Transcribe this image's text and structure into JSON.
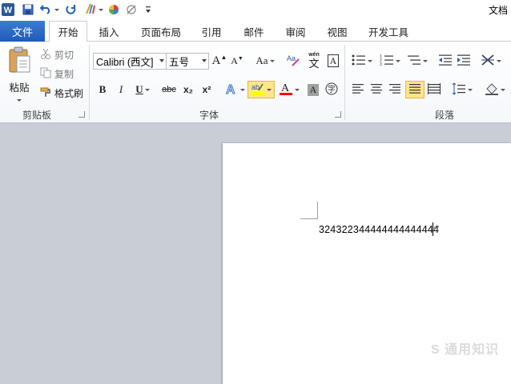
{
  "app": {
    "title": "文档"
  },
  "tabs": {
    "file": "文件",
    "items": [
      "开始",
      "插入",
      "页面布局",
      "引用",
      "邮件",
      "审阅",
      "视图",
      "开发工具"
    ]
  },
  "clipboard": {
    "paste": "粘贴",
    "cut": "剪切",
    "copy": "复制",
    "format_painter": "格式刷",
    "group_label": "剪贴板"
  },
  "font": {
    "family": "Calibri (西文]",
    "size": "五号",
    "group_label": "字体",
    "change_case": "Aa",
    "bold": "B",
    "italic": "I",
    "underline": "U",
    "strikethrough": "abc",
    "subscript": "x₂",
    "superscript": "x²",
    "phonetic": "wén",
    "phonetic_char": "文",
    "char_border": "A",
    "highlight_color": "#ffff00",
    "font_color": "#ff0000"
  },
  "paragraph": {
    "group_label": "段落"
  },
  "document": {
    "text": "324322344444444444444",
    "watermark": "S 通用知识"
  }
}
